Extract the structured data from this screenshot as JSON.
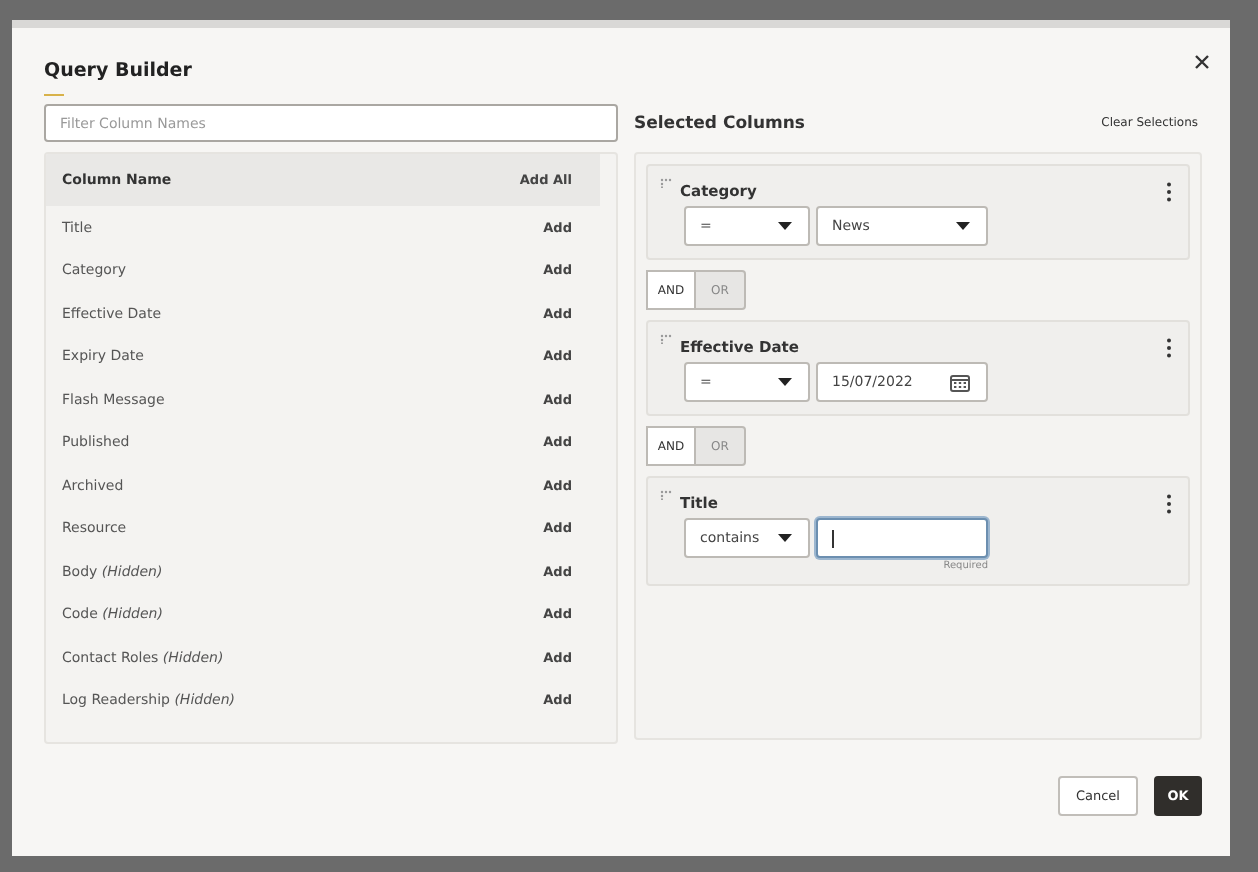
{
  "dialog": {
    "title": "Query Builder"
  },
  "filter": {
    "placeholder": "Filter Column Names"
  },
  "column_list": {
    "header": "Column Name",
    "add_all": "Add All",
    "rows": [
      {
        "name": "Title",
        "action": "Add"
      },
      {
        "name": "Category",
        "action": "Add"
      },
      {
        "name": "Effective Date",
        "action": "Add"
      },
      {
        "name": "Expiry Date",
        "action": "Add"
      },
      {
        "name": "Flash Message",
        "action": "Add"
      },
      {
        "name": "Published",
        "action": "Add"
      },
      {
        "name": "Archived",
        "action": "Add"
      },
      {
        "name": "Resource",
        "action": "Add"
      },
      {
        "name": "Body  *(Hidden)*",
        "action": "Add"
      },
      {
        "name": "Code  *(Hidden)*",
        "action": "Add"
      },
      {
        "name": "Contact Roles  *(Hidden)*",
        "action": "Add"
      },
      {
        "name": "Log Readership  *(Hidden)*",
        "action": "Add"
      }
    ]
  },
  "selected_columns": {
    "title": "Selected Columns",
    "clear": "Clear Selections",
    "items": [
      {
        "kind": "condition",
        "name": "Category",
        "operator": "=",
        "input": {
          "kind": "select",
          "value": "News",
          "focused": false
        }
      },
      {
        "kind": "connector",
        "options": [
          {
            "label": "AND",
            "selected": true
          },
          {
            "label": "OR",
            "selected": false
          }
        ]
      },
      {
        "kind": "condition",
        "name": "Effective Date",
        "operator": "=",
        "input": {
          "kind": "date",
          "value": "15/07/2022",
          "focused": false
        }
      },
      {
        "kind": "connector",
        "options": [
          {
            "label": "AND",
            "selected": true
          },
          {
            "label": "OR",
            "selected": false
          }
        ]
      },
      {
        "kind": "condition",
        "name": "Title",
        "operator": "contains",
        "input": {
          "kind": "text",
          "focused": true,
          "hint": "Required"
        }
      }
    ]
  },
  "buttons": [
    {
      "label": "Cancel",
      "kind": "secondary"
    },
    {
      "label": "OK",
      "kind": "primary"
    }
  ]
}
